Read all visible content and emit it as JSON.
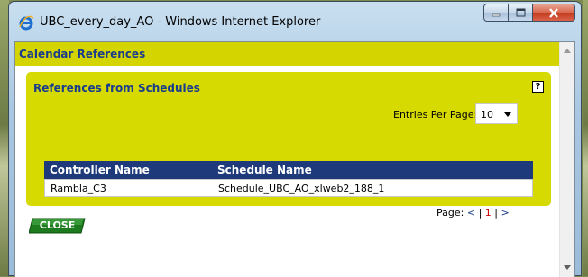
{
  "window": {
    "title": "UBC_every_day_AO - Windows Internet Explorer",
    "icon": "ie-icon"
  },
  "panel": {
    "title": "Calendar References"
  },
  "references": {
    "title": "References from Schedules",
    "help_label": "?",
    "entries_label": "Entries Per Page:",
    "entries_value": "10",
    "columns": [
      "Controller Name",
      "Schedule Name"
    ],
    "rows": [
      {
        "controller": "Rambla_C3",
        "schedule": "Schedule_UBC_AO_xlweb2_188_1"
      }
    ],
    "pager": {
      "label": "Page:",
      "prev": "<",
      "sep1": "|",
      "current": "1",
      "sep2": "|",
      "next": ">"
    }
  },
  "buttons": {
    "close_label": "CLOSE"
  },
  "colors": {
    "panel_yellow": "#d4d400",
    "header_blue": "#1e3a7a",
    "title_blue": "#1a3c8c",
    "close_green": "#2e8b2e"
  }
}
